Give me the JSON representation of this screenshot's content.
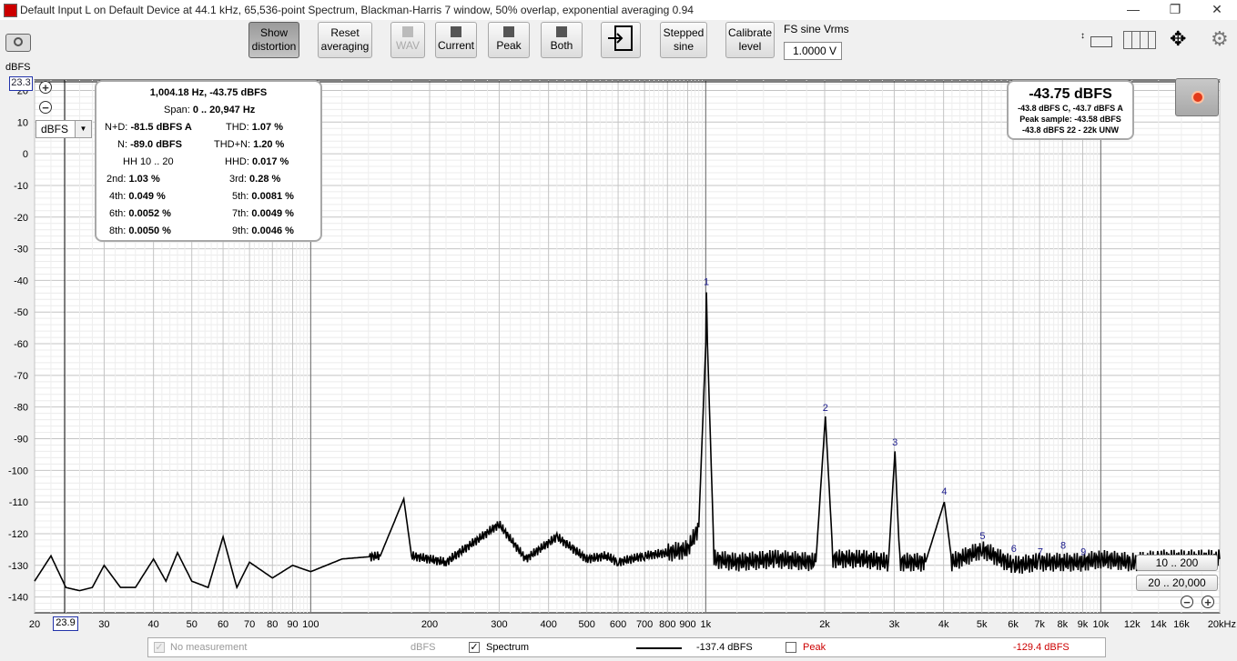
{
  "window": {
    "title": "Default Input L on Default Device at 44.1 kHz, 65,536-point Spectrum, Blackman-Harris 7 window, 50% overlap, exponential averaging 0.94",
    "minimize": "—",
    "maximize": "❐",
    "close": "✕"
  },
  "toolbar": {
    "show_distortion": [
      "Show",
      "distortion"
    ],
    "reset_averaging": [
      "Reset",
      "averaging"
    ],
    "wav": "WAV",
    "current": "Current",
    "peak": "Peak",
    "both": "Both",
    "stepped_sine": [
      "Stepped",
      "sine"
    ],
    "calibrate_level": [
      "Calibrate",
      "level"
    ],
    "fs_sine_label": "FS sine Vrms",
    "fs_sine_value": "1.0000 V"
  },
  "plot": {
    "y_unit_label": "dBFS",
    "unit_select": "dBFS",
    "y_max_box": "23.3",
    "x_min_box": "23.9",
    "y_ticks": [
      "20",
      "10",
      "0",
      "-10",
      "-20",
      "-30",
      "-40",
      "-50",
      "-60",
      "-70",
      "-80",
      "-90",
      "-100",
      "-110",
      "-120",
      "-130",
      "-140"
    ],
    "x_ticks": [
      "20",
      "30",
      "40",
      "50",
      "60",
      "70",
      "80",
      "90",
      "100",
      "200",
      "300",
      "400",
      "500",
      "600",
      "700",
      "800",
      "900",
      "1k",
      "2k",
      "3k",
      "4k",
      "5k",
      "6k",
      "7k",
      "8k",
      "9k",
      "10k",
      "12k",
      "14k",
      "16k",
      "20kHz"
    ],
    "harmonic_labels": [
      "1",
      "2",
      "3",
      "4",
      "5",
      "6",
      "7",
      "8",
      "9"
    ]
  },
  "chart_data": {
    "type": "line",
    "xscale": "log",
    "xlabel": "",
    "ylabel": "dBFS",
    "xlim": [
      20,
      20000
    ],
    "ylim": [
      -145,
      23.3
    ],
    "grid": true,
    "series": [
      {
        "name": "Spectrum",
        "color": "#000000",
        "x": [
          20,
          22,
          24,
          26,
          28,
          30,
          33,
          36,
          40,
          43,
          46,
          50,
          55,
          60,
          65,
          70,
          80,
          90,
          100,
          120,
          150,
          172,
          180,
          220,
          300,
          350,
          420,
          500,
          560,
          600,
          700,
          800,
          900,
          960,
          1000,
          1004,
          1010,
          1050,
          1200,
          1500,
          1900,
          2008,
          2100,
          2500,
          2900,
          3012,
          3100,
          3600,
          4016,
          4200,
          5020,
          6000,
          7000,
          8000,
          9000,
          10000,
          12000,
          14000,
          16000,
          20000
        ],
        "values": [
          -135,
          -127,
          -137,
          -138,
          -137,
          -130,
          -137,
          -137,
          -128,
          -135,
          -126,
          -135,
          -137,
          -121,
          -137,
          -129,
          -134,
          -130,
          -132,
          -128,
          -127,
          -109,
          -127,
          -129,
          -117,
          -128,
          -121,
          -128,
          -127,
          -129,
          -127,
          -126,
          -125,
          -118,
          -60,
          -43.75,
          -60,
          -128,
          -129,
          -128,
          -129,
          -83,
          -128,
          -128,
          -129,
          -94,
          -129,
          -129,
          -110,
          -129,
          -125,
          -130,
          -129,
          -129,
          -129,
          -128,
          -129,
          -128,
          -128,
          -128
        ]
      }
    ],
    "markers": [
      {
        "label": "1",
        "x": 1004,
        "y": -43.75
      },
      {
        "label": "2",
        "x": 2008,
        "y": -83.5
      },
      {
        "label": "3",
        "x": 3012,
        "y": -94.5
      },
      {
        "label": "4",
        "x": 4016,
        "y": -110
      },
      {
        "label": "5",
        "x": 5020,
        "y": -124
      },
      {
        "label": "6",
        "x": 6024,
        "y": -128
      },
      {
        "label": "7",
        "x": 7028,
        "y": -129
      },
      {
        "label": "8",
        "x": 8032,
        "y": -127
      },
      {
        "label": "9",
        "x": 9036,
        "y": -129
      }
    ]
  },
  "stats": {
    "freq_level": "1,004.18 Hz, -43.75 dBFS",
    "span_label": "Span:",
    "span_value": "0 .. 20,947 Hz",
    "nd_label": "N+D:",
    "nd_value": "-81.5 dBFS A",
    "thd_label": "THD:",
    "thd_value": "1.07 %",
    "n_label": "N:",
    "n_value": "-89.0 dBFS",
    "thdn_label": "THD+N:",
    "thdn_value": "1.20 %",
    "hh_label": "HH 10 .. 20",
    "hhd_label": "HHD:",
    "hhd_value": "0.017 %",
    "h2_label": "2nd:",
    "h2_value": "1.03 %",
    "h3_label": "3rd:",
    "h3_value": "0.28 %",
    "h4_label": "4th:",
    "h4_value": "0.049 %",
    "h5_label": "5th:",
    "h5_value": "0.0081 %",
    "h6_label": "6th:",
    "h6_value": "0.0052 %",
    "h7_label": "7th:",
    "h7_value": "0.0049 %",
    "h8_label": "8th:",
    "h8_value": "0.0050 %",
    "h9_label": "9th:",
    "h9_value": "0.0046 %"
  },
  "readout": {
    "main": "-43.75 dBFS",
    "line1": "-43.8 dBFS C, -43.7 dBFS A",
    "line2": "Peak sample: -43.58 dBFS",
    "line3": "-43.8 dBFS 22 - 22k UNW"
  },
  "ranges": {
    "r1": "10 .. 200",
    "r2": "20 .. 20,000"
  },
  "legend": {
    "no_measurement": "No measurement",
    "no_measurement_unit": "dBFS",
    "spectrum": "Spectrum",
    "spectrum_value": "-137.4 dBFS",
    "peak": "Peak",
    "peak_value": "-129.4 dBFS",
    "peak_color": "#cc0000"
  }
}
